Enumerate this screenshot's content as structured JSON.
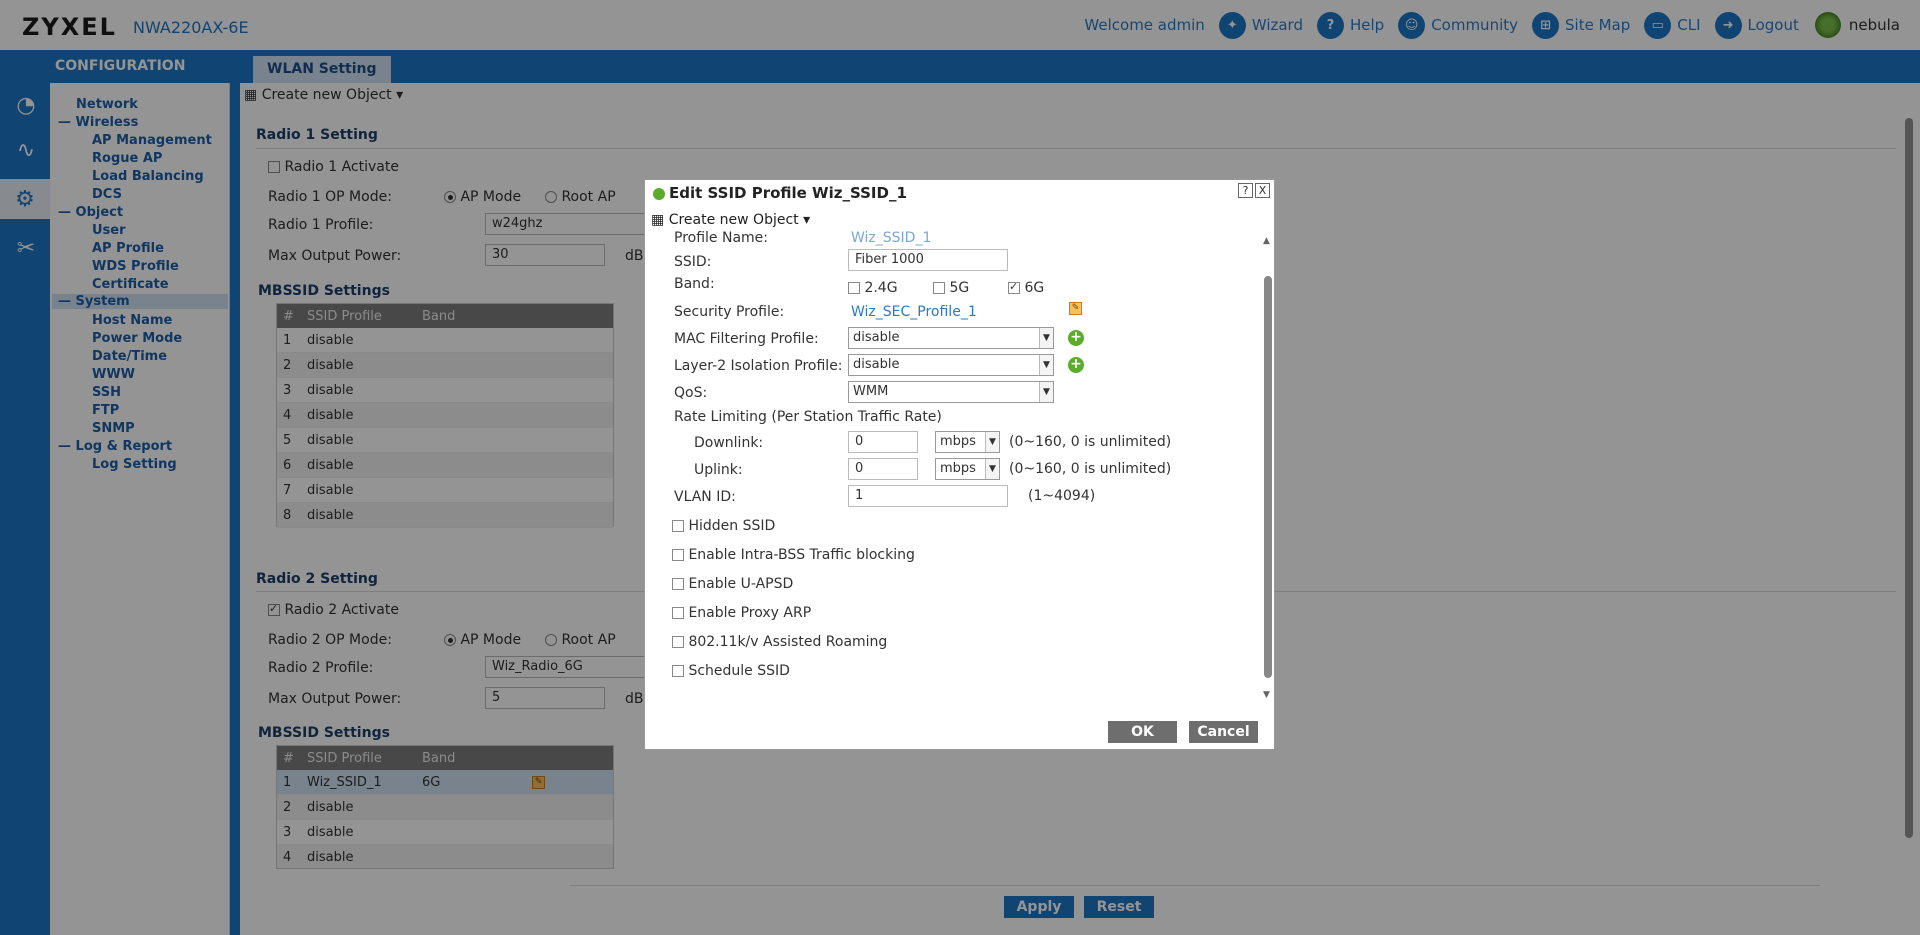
{
  "header": {
    "brand": "ZYXEL",
    "model": "NWA220AX-6E",
    "welcome": "Welcome admin",
    "links": [
      "Wizard",
      "Help",
      "Community",
      "Site Map",
      "CLI",
      "Logout"
    ],
    "nebula": "nebula"
  },
  "bar": {
    "section": "CONFIGURATION",
    "tab": "WLAN Setting"
  },
  "nav": {
    "network": "Network",
    "wireless": "Wireless",
    "ap_management": "AP Management",
    "rogue_ap": "Rogue AP",
    "load_balancing": "Load Balancing",
    "dcs": "DCS",
    "object": "Object",
    "user": "User",
    "ap_profile": "AP Profile",
    "wds_profile": "WDS Profile",
    "certificate": "Certificate",
    "system": "System",
    "host_name": "Host Name",
    "power_mode": "Power Mode",
    "date_time": "Date/Time",
    "www": "WWW",
    "ssh": "SSH",
    "ftp": "FTP",
    "snmp": "SNMP",
    "log_report": "Log & Report",
    "log_setting": "Log Setting"
  },
  "main": {
    "create_new": "Create new Object",
    "radio1": {
      "heading": "Radio 1 Setting",
      "activate": "Radio 1 Activate",
      "op_mode_label": "Radio 1 OP Mode:",
      "ap_mode": "AP Mode",
      "root_ap": "Root AP",
      "profile_label": "Radio 1 Profile:",
      "profile_value": "w24ghz",
      "power_label": "Max Output Power:",
      "power_value": "30",
      "power_unit": "dB"
    },
    "radio2": {
      "heading": "Radio 2 Setting",
      "activate": "Radio 2 Activate",
      "op_mode_label": "Radio 2 OP Mode:",
      "ap_mode": "AP Mode",
      "root_ap": "Root AP",
      "profile_label": "Radio 2 Profile:",
      "profile_value": "Wiz_Radio_6G",
      "power_label": "Max Output Power:",
      "power_value": "5",
      "power_unit": "dB"
    },
    "mbssid_heading": "MBSSID Settings",
    "table_headers": [
      "#",
      "SSID Profile",
      "Band"
    ],
    "table1_rows": [
      {
        "n": "1",
        "ssid": "disable",
        "band": ""
      },
      {
        "n": "2",
        "ssid": "disable",
        "band": ""
      },
      {
        "n": "3",
        "ssid": "disable",
        "band": ""
      },
      {
        "n": "4",
        "ssid": "disable",
        "band": ""
      },
      {
        "n": "5",
        "ssid": "disable",
        "band": ""
      },
      {
        "n": "6",
        "ssid": "disable",
        "band": ""
      },
      {
        "n": "7",
        "ssid": "disable",
        "band": ""
      },
      {
        "n": "8",
        "ssid": "disable",
        "band": ""
      }
    ],
    "table2_rows": [
      {
        "n": "1",
        "ssid": "Wiz_SSID_1",
        "band": "6G"
      },
      {
        "n": "2",
        "ssid": "disable",
        "band": ""
      },
      {
        "n": "3",
        "ssid": "disable",
        "band": ""
      },
      {
        "n": "4",
        "ssid": "disable",
        "band": ""
      }
    ],
    "apply": "Apply",
    "reset": "Reset"
  },
  "dialog": {
    "title": "Edit SSID Profile Wiz_SSID_1",
    "help": "?",
    "close": "X",
    "create_new": "Create new Object",
    "profile_name_label": "Profile Name:",
    "profile_name_value": "Wiz_SSID_1",
    "ssid_label": "SSID:",
    "ssid_value": "Fiber 1000",
    "band_label": "Band:",
    "band_24": "2.4G",
    "band_5": "5G",
    "band_6": "6G",
    "security_label": "Security Profile:",
    "security_value": "Wiz_SEC_Profile_1",
    "mac_label": "MAC Filtering Profile:",
    "mac_value": "disable",
    "l2_label": "Layer-2 Isolation Profile:",
    "l2_value": "disable",
    "qos_label": "QoS:",
    "qos_value": "WMM",
    "rate_label": "Rate Limiting (Per Station Traffic Rate)",
    "downlink_label": "Downlink:",
    "downlink_value": "0",
    "uplink_label": "Uplink:",
    "uplink_value": "0",
    "rate_unit": "mbps",
    "rate_hint": "(0~160, 0 is unlimited)",
    "vlan_label": "VLAN ID:",
    "vlan_value": "1",
    "vlan_hint": "(1~4094)",
    "opt_hidden": "Hidden SSID",
    "opt_intra": "Enable Intra-BSS Traffic blocking",
    "opt_uapsd": "Enable U-APSD",
    "opt_proxy": "Enable Proxy ARP",
    "opt_roam": "802.11k/v Assisted Roaming",
    "opt_sched": "Schedule SSID",
    "ok": "OK",
    "cancel": "Cancel"
  },
  "colors": {
    "brand_blue": "#1d76c7",
    "accent_green": "#5aac2a",
    "button_gray": "#707070"
  }
}
